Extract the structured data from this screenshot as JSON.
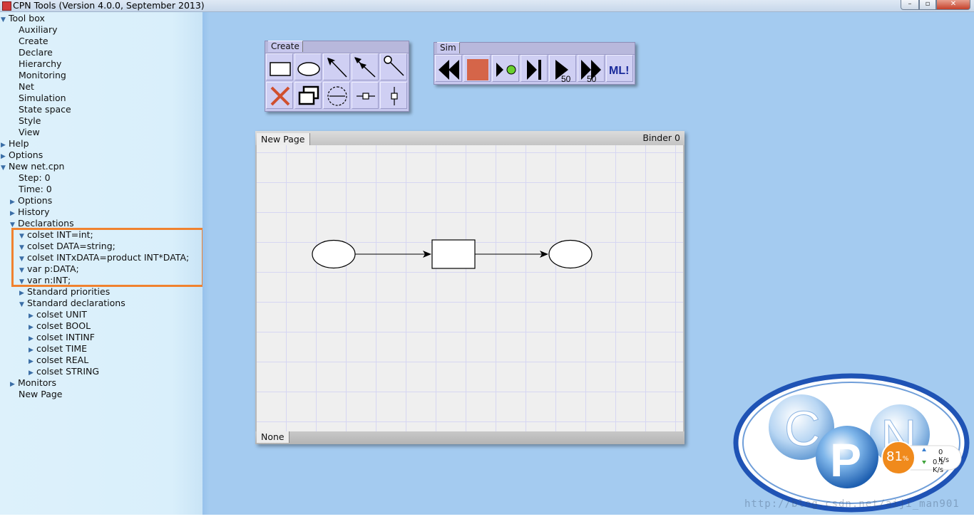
{
  "window": {
    "title": "CPN Tools (Version 4.0.0, September 2013)",
    "buttons": [
      "minimize",
      "maximize",
      "close"
    ]
  },
  "index": {
    "rows": [
      {
        "text": "Tool box",
        "tri": "▼"
      },
      {
        "text": "Auxiliary",
        "tri": ""
      },
      {
        "text": "Create",
        "tri": ""
      },
      {
        "text": "Declare",
        "tri": ""
      },
      {
        "text": "Hierarchy",
        "tri": ""
      },
      {
        "text": "Monitoring",
        "tri": ""
      },
      {
        "text": "Net",
        "tri": ""
      },
      {
        "text": "Simulation",
        "tri": ""
      },
      {
        "text": "State space",
        "tri": ""
      },
      {
        "text": "Style",
        "tri": ""
      },
      {
        "text": "View",
        "tri": ""
      },
      {
        "text": "Help",
        "tri": "▶"
      },
      {
        "text": "Options",
        "tri": "▶"
      },
      {
        "text": "New net.cpn",
        "tri": "▼"
      },
      {
        "text": "Step: 0",
        "tri": ""
      },
      {
        "text": "Time: 0",
        "tri": ""
      },
      {
        "text": "Options",
        "tri": "▶"
      },
      {
        "text": "History",
        "tri": "▶"
      },
      {
        "text": "Declarations",
        "tri": "▼"
      },
      {
        "text": "colset INT=int;",
        "tri": "▼"
      },
      {
        "text": "colset DATA=string;",
        "tri": "▼"
      },
      {
        "text": "colset INTxDATA=product INT*DATA;",
        "tri": "▼"
      },
      {
        "text": "var p:DATA;",
        "tri": "▼"
      },
      {
        "text": "var n:INT;",
        "tri": "▼"
      },
      {
        "text": "Standard priorities",
        "tri": "▶"
      },
      {
        "text": "Standard declarations",
        "tri": "▼"
      },
      {
        "text": "colset UNIT",
        "tri": "▶"
      },
      {
        "text": "colset BOOL",
        "tri": "▶"
      },
      {
        "text": "colset INTINF",
        "tri": "▶"
      },
      {
        "text": "colset TIME",
        "tri": "▶"
      },
      {
        "text": "colset REAL",
        "tri": "▶"
      },
      {
        "text": "colset STRING",
        "tri": "▶"
      },
      {
        "text": "Monitors",
        "tri": "▶"
      },
      {
        "text": "New Page",
        "tri": ""
      }
    ]
  },
  "palettes": {
    "create": {
      "label": "Create",
      "tools": [
        "transition-tool",
        "place-tool",
        "arc-tool",
        "double-arc-tool",
        "reset-arc-tool",
        "delete-tool",
        "clone-tool",
        "toggle-arc-direction-tool",
        "horizontal-guideline-tool",
        "vertical-guideline-tool"
      ]
    },
    "sim": {
      "label": "Sim",
      "tools": [
        "rewind-tool",
        "stop-tool",
        "play-single-step-tool",
        "single-step-tool",
        "play-50-tool",
        "fast-forward-50-tool",
        "ml-evaluate-tool"
      ],
      "play_count": "50",
      "ff_count": "50",
      "ml_label": "ML!"
    }
  },
  "binder": {
    "label": "Binder 0",
    "page_tab": "New Page",
    "bottom_tab": "None"
  },
  "net": {
    "place_fill": "#ffffff",
    "transition_fill": "#ffffff",
    "stroke": "#000000"
  },
  "logo": {
    "letters": [
      "C",
      "P",
      "N"
    ]
  },
  "speed_widget": {
    "percent": "81",
    "percent_unit": "%",
    "up": "0 K/s",
    "down": "0.1 K/s"
  },
  "watermark": "http://blog.csdn.net/aiji_man901",
  "colors": {
    "workspace": "#a4cbf0",
    "index_bg": "#ddf1fb",
    "highlight": "#f0822f",
    "palette": "#c8c8ee"
  }
}
